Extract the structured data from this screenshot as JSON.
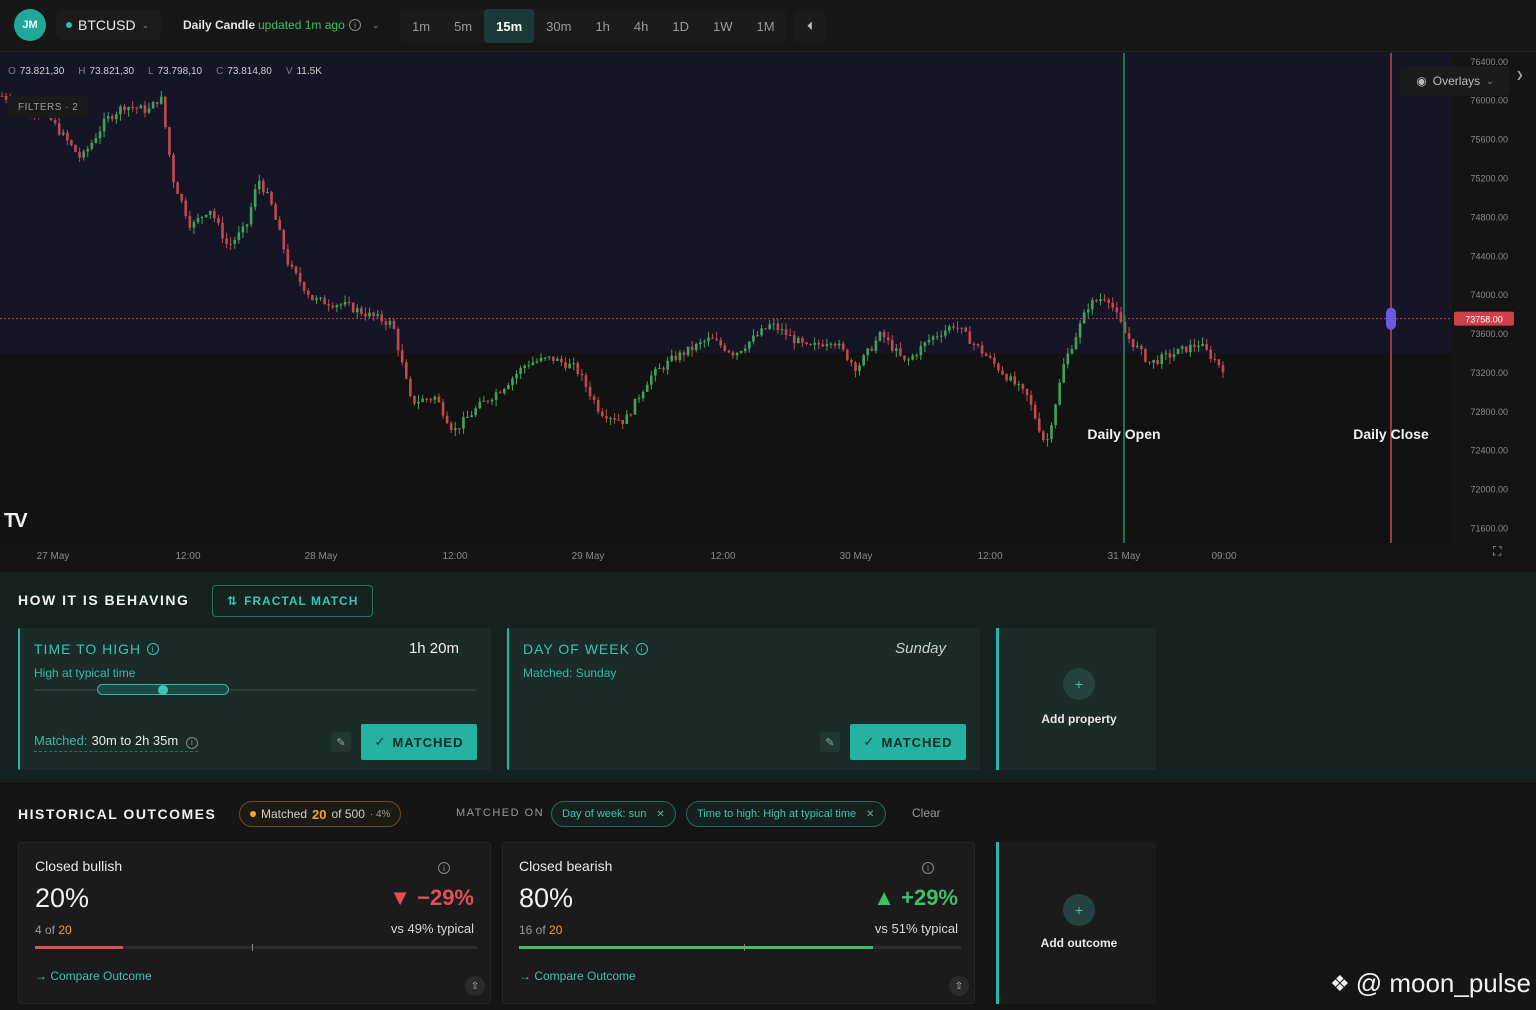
{
  "topbar": {
    "avatar": "JM",
    "symbol": "BTCUSD",
    "candle_label": "Daily Candle",
    "candle_updated": "updated 1m ago",
    "timeframes": [
      "1m",
      "5m",
      "15m",
      "30m",
      "1h",
      "4h",
      "1D",
      "1W",
      "1M"
    ],
    "active_timeframe": "15m"
  },
  "chart": {
    "ohlc": {
      "o": "73.821,30",
      "h": "73.821,30",
      "l": "73.798,10",
      "c": "73.814,80",
      "v": "11.5K"
    },
    "filters": "FILTERS · 2",
    "overlays": "Overlays",
    "current_price": "73758.00",
    "daily_open_label": "Daily Open",
    "daily_close_label": "Daily Close",
    "tv_logo": "TV"
  },
  "chart_data": {
    "type": "candlestick",
    "y_ticks": [
      "76400.00",
      "76000.00",
      "75600.00",
      "75200.00",
      "74800.00",
      "74400.00",
      "74000.00",
      "73600.00",
      "73200.00",
      "72800.00",
      "72400.00",
      "72000.00",
      "71600.00"
    ],
    "ylim": [
      71450,
      76450
    ],
    "x_ticks": [
      "27 May",
      "12:00",
      "28 May",
      "12:00",
      "29 May",
      "12:00",
      "30 May",
      "12:00",
      "31 May",
      "09:00"
    ],
    "current_price": 73758,
    "price_path": [
      [
        0,
        76050
      ],
      [
        0.02,
        75950
      ],
      [
        0.04,
        75800
      ],
      [
        0.065,
        75400
      ],
      [
        0.085,
        75800
      ],
      [
        0.1,
        75950
      ],
      [
        0.12,
        75900
      ],
      [
        0.13,
        76050
      ],
      [
        0.14,
        75200
      ],
      [
        0.155,
        74700
      ],
      [
        0.17,
        74900
      ],
      [
        0.185,
        74500
      ],
      [
        0.2,
        74700
      ],
      [
        0.21,
        75200
      ],
      [
        0.22,
        74950
      ],
      [
        0.235,
        74300
      ],
      [
        0.255,
        73950
      ],
      [
        0.28,
        73900
      ],
      [
        0.3,
        73800
      ],
      [
        0.32,
        73700
      ],
      [
        0.335,
        72900
      ],
      [
        0.355,
        72950
      ],
      [
        0.37,
        72600
      ],
      [
        0.39,
        72850
      ],
      [
        0.41,
        73050
      ],
      [
        0.43,
        73300
      ],
      [
        0.45,
        73350
      ],
      [
        0.47,
        73250
      ],
      [
        0.49,
        72800
      ],
      [
        0.51,
        72700
      ],
      [
        0.53,
        73150
      ],
      [
        0.55,
        73350
      ],
      [
        0.58,
        73550
      ],
      [
        0.6,
        73400
      ],
      [
        0.63,
        73700
      ],
      [
        0.66,
        73450
      ],
      [
        0.68,
        73550
      ],
      [
        0.7,
        73250
      ],
      [
        0.72,
        73600
      ],
      [
        0.74,
        73300
      ],
      [
        0.76,
        73550
      ],
      [
        0.78,
        73700
      ],
      [
        0.8,
        73450
      ],
      [
        0.82,
        73200
      ],
      [
        0.84,
        72950
      ],
      [
        0.855,
        72450
      ],
      [
        0.87,
        73300
      ],
      [
        0.89,
        73900
      ],
      [
        0.905,
        74000
      ],
      [
        0.92,
        73600
      ],
      [
        0.94,
        73300
      ],
      [
        0.96,
        73400
      ],
      [
        0.98,
        73500
      ],
      [
        1.0,
        73250
      ]
    ]
  },
  "behaving": {
    "title": "HOW IT IS BEHAVING",
    "fractal_button": "FRACTAL MATCH",
    "time_to_high": {
      "title": "TIME TO HIGH",
      "value": "1h 20m",
      "sub": "High at typical time",
      "matched_label": "Matched:",
      "matched_value": "30m to 2h 35m",
      "button": "MATCHED"
    },
    "day_of_week": {
      "title": "DAY OF WEEK",
      "value": "Sunday",
      "sub": "Matched: Sunday",
      "button": "MATCHED"
    },
    "add_property": "Add property"
  },
  "outcomes": {
    "title": "HISTORICAL OUTCOMES",
    "matched_label": "Matched",
    "matched_count": "20",
    "matched_of": "of 500",
    "matched_pct": "· 4%",
    "matched_on": "MATCHED ON",
    "chips": [
      "Day of week: sun",
      "Time to high: High at typical time"
    ],
    "clear": "Clear",
    "bullish": {
      "title": "Closed bullish",
      "pct": "20%",
      "delta": "▼ −29%",
      "count_prefix": "4 of",
      "count_total": "20",
      "typical": "vs 49% typical",
      "fill": 0.2,
      "typical_fraction": 0.49,
      "compare": "Compare Outcome",
      "color": "#e0505a"
    },
    "bearish": {
      "title": "Closed bearish",
      "pct": "80%",
      "delta": "▲ +29%",
      "count_prefix": "16 of",
      "count_total": "20",
      "typical": "vs 51% typical",
      "fill": 0.8,
      "typical_fraction": 0.51,
      "compare": "Compare Outcome",
      "color": "#3fbf68"
    },
    "add_outcome": "Add outcome"
  },
  "watermark": "@ moon_pulse"
}
